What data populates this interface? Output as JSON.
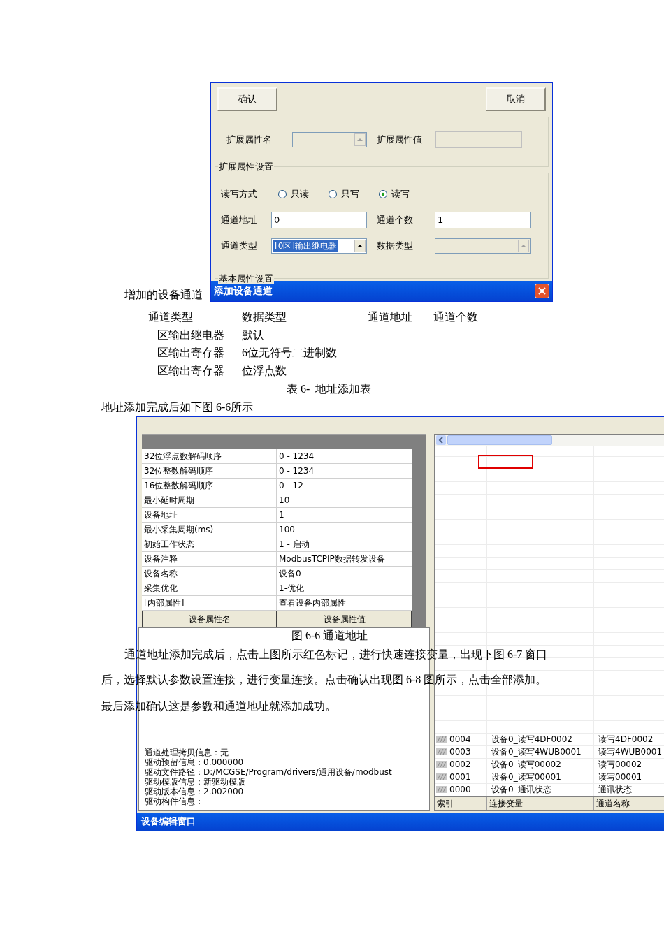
{
  "dialog": {
    "buttons": [
      {
        "label": "确认"
      },
      {
        "label": "取消"
      }
    ],
    "ext_group": {
      "name_label": "扩展属性名",
      "name_disabled": true,
      "value_label": "扩展属性值",
      "title": "扩展属性设置"
    },
    "basic_group": {
      "rw_label": "读写方式",
      "rw_options": [
        {
          "label": "只读",
          "selected": false
        },
        {
          "label": "只写",
          "selected": false
        },
        {
          "label": "读写",
          "selected": true
        }
      ],
      "fields": [
        {
          "label": "通道地址",
          "value": "0"
        },
        {
          "label": "通道个数",
          "value": "1"
        }
      ],
      "channel_type": {
        "label": "通道类型",
        "value": "[0区]输出继电器"
      },
      "data_type": {
        "label": "数据类型",
        "disabled": true
      },
      "title": "基本属性设置"
    },
    "title": "添加设备通道"
  },
  "intro": "增加的设备通道",
  "address_table": {
    "columns": [
      "通道类型",
      "数据类型",
      "通道地址",
      "通道个数"
    ],
    "rows": [
      [
        "区输出继电器",
        "默认"
      ],
      [
        "区输出寄存器",
        "6位无符号二进制数"
      ],
      [
        "区输出寄存器",
        "位浮点数"
      ]
    ],
    "caption": "表 6-  地址添加表"
  },
  "lead": "地址添加完成后如下图 6-6所示",
  "editor": {
    "properties": [
      [
        "32位浮点数解码顺序",
        "0 - 1234"
      ],
      [
        "32位整数解码顺序",
        "0 - 1234"
      ],
      [
        "16位整数解码顺序",
        "0 - 12"
      ],
      [
        "最小延时周期",
        "10"
      ],
      [
        "设备地址",
        "1"
      ],
      [
        "最小采集周期(ms)",
        "100"
      ],
      [
        "初始工作状态",
        "1 - 启动"
      ],
      [
        "设备注释",
        "ModbusTCPIP数据转发设备"
      ],
      [
        "设备名称",
        "设备0"
      ],
      [
        "采集优化",
        "1-优化"
      ],
      [
        "[内部属性]",
        "查看设备内部属性"
      ]
    ],
    "property_columns": [
      "设备属性名",
      "设备属性值"
    ],
    "info_lines": [
      "通道处理拷贝信息：无",
      "驱动预留信息：0.000000",
      "驱动文件路径：D:/MCGSE/Program/drivers/通用设备/modbust",
      "驱动模版信息：新驱动模版",
      "驱动版本信息：2.002000",
      "驱动构件信息："
    ],
    "channels": [
      [
        "0004",
        "设备0_读写4DF0002",
        "读写4DF0002"
      ],
      [
        "0003",
        "设备0_读写4WUB0001",
        "读写4WUB0001"
      ],
      [
        "0002",
        "设备0_读写00002",
        "读写00002"
      ],
      [
        "0001",
        "设备0_读写00001",
        "读写00001"
      ],
      [
        "0000",
        "设备0_通讯状态",
        "通讯状态"
      ]
    ],
    "channel_columns": [
      "索引",
      "连接变量",
      "通道名称"
    ],
    "title": "设备编辑窗口"
  },
  "figure_caption": "图 6-6 通道地址",
  "paragraph_lines": [
    "通道地址添加完成后，点击上图所示红色标记，进行快速连接变量，出现下图 6-7 窗口",
    "后，选择默认参数设置连接，进行变量连接。点击确认出现图 6-8 图所示，点击全部添加。",
    "最后添加确认这是参数和通道地址就添加成功。"
  ]
}
